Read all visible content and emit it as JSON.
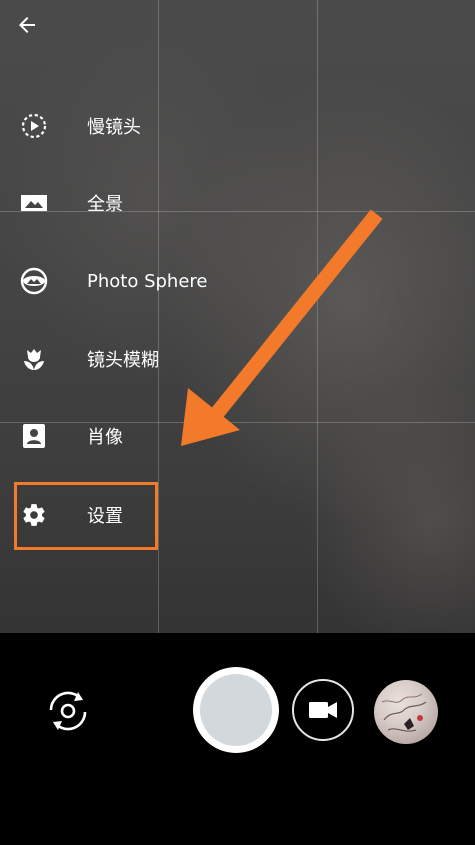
{
  "top": {
    "back_icon": "arrow-back-icon"
  },
  "menu": {
    "items": [
      {
        "label": "慢镜头",
        "icon": "slow-motion-icon"
      },
      {
        "label": "全景",
        "icon": "panorama-icon"
      },
      {
        "label": "Photo Sphere",
        "icon": "photo-sphere-icon"
      },
      {
        "label": "镜头模糊",
        "icon": "tulip-lens-blur-icon"
      },
      {
        "label": "肖像",
        "icon": "portrait-icon"
      },
      {
        "label": "设置",
        "icon": "gear-icon"
      }
    ]
  },
  "annotation": {
    "color": "#f27a2a"
  },
  "controls": {
    "switch_camera_icon": "switch-camera-icon",
    "shutter_icon": "shutter-button",
    "video_icon": "videocam-icon",
    "gallery_icon": "gallery-thumbnail"
  }
}
